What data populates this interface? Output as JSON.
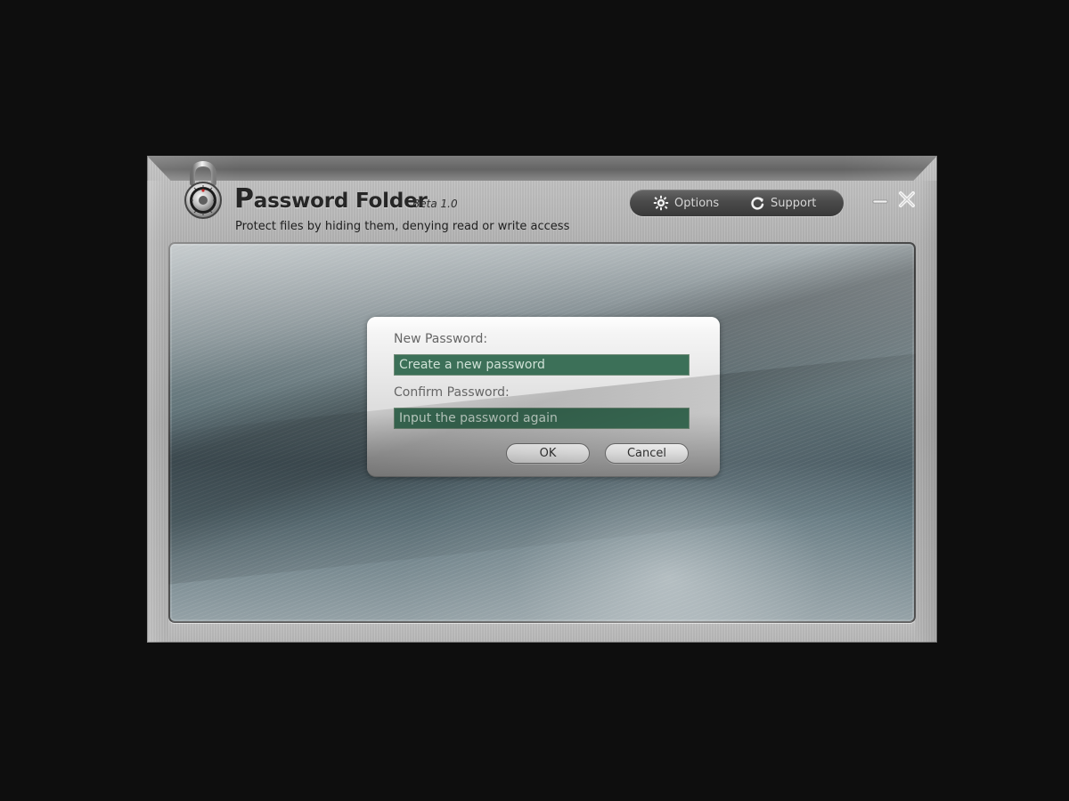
{
  "window": {
    "title_initial": "P",
    "title_rest": "assword Folder",
    "version": "Beta 1.0",
    "subtitle": "Protect files by hiding them, denying read or write access"
  },
  "toolbar": {
    "options_label": "Options",
    "support_label": "Support",
    "options_icon": "gear-icon",
    "support_icon": "refresh-icon"
  },
  "window_controls": {
    "minimize_icon": "minimize-icon",
    "close_icon": "close-icon"
  },
  "dialog": {
    "new_password_label": "New Password:",
    "new_password_placeholder": "Create a new password",
    "confirm_password_label": "Confirm Password:",
    "confirm_password_placeholder": "Input the password again",
    "ok_label": "OK",
    "cancel_label": "Cancel"
  },
  "colors": {
    "input_fill": "#3c7058",
    "input_text": "#dcebe1",
    "toolbar_dark": "#4a4a4a"
  }
}
